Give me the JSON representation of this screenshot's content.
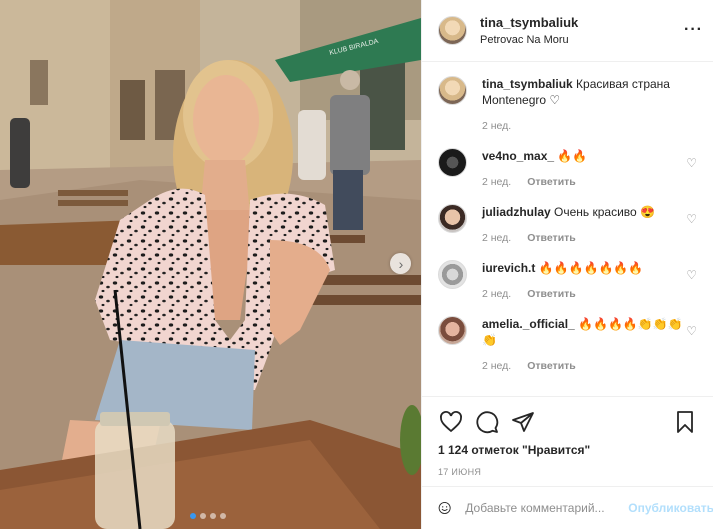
{
  "post": {
    "author": "tina_tsymbaliuk",
    "location": "Petrovac Na Moru",
    "caption": {
      "username": "tina_tsymbaliuk",
      "text": "Красивая страна Montenegro ♡",
      "time": "2 нед."
    },
    "comments": [
      {
        "username": "ve4no_max_",
        "text": "🔥🔥",
        "time": "2 нед.",
        "reply": "Ответить",
        "avatar": "ve4no-avatar"
      },
      {
        "username": "juliadzhulay",
        "text": "Очень красиво 😍",
        "time": "2 нед.",
        "reply": "Ответить",
        "avatar": "julia-avatar"
      },
      {
        "username": "iurevich.t",
        "text": "🔥🔥🔥🔥🔥🔥🔥",
        "time": "2 нед.",
        "reply": "Ответить",
        "avatar": "iurevich-avatar"
      },
      {
        "username": "amelia._official_",
        "text": "🔥🔥🔥🔥👏👏👏👏",
        "time": "2 нед.",
        "reply": "Ответить",
        "avatar": "amelia-avatar"
      }
    ],
    "likes": "1 124 отметок \"Нравится\"",
    "date": "17 ИЮНЯ",
    "add_comment": {
      "placeholder": "Добавьте комментарий...",
      "publish": "Опубликовать"
    },
    "photo": {
      "sign_text": "KLUB BIRALDA",
      "current_slide": 1,
      "total_slides": 4
    }
  },
  "icons": {
    "more": "more-options-icon",
    "like": "heart-icon",
    "comment": "comment-icon",
    "share": "paper-plane-icon",
    "save": "bookmark-icon",
    "emoji": "emoji-icon",
    "next": "chevron-right-icon"
  },
  "colors": {
    "accent": "#3897f0",
    "publish_disabled": "#b2dffc",
    "secondary_text": "#8e8e8e",
    "border": "#efefef"
  }
}
